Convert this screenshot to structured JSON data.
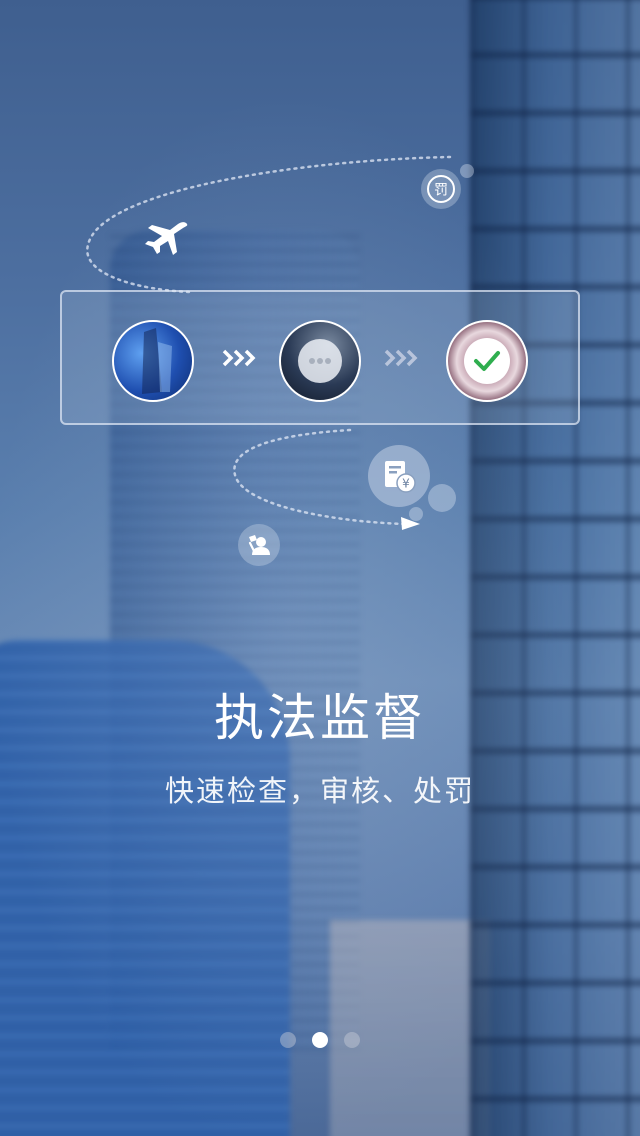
{
  "onboarding": {
    "title": "执法监督",
    "subtitle": "快速检查，审核、处罚",
    "page_indicator": {
      "total": 3,
      "active_index": 1
    }
  },
  "icons": {
    "penalty": "penalty-badge-icon",
    "plane": "airplane-icon",
    "fine_document": "fine-document-icon",
    "officer": "officer-user-icon",
    "step1": "building-photo-icon",
    "step2": "processing-dots-icon",
    "step3": "approved-check-icon",
    "arrows": "triple-chevron-icon"
  },
  "icon_text": {
    "penalty_glyph": "罚",
    "fine_glyph": "¥"
  },
  "colors": {
    "check": "#2fae4f",
    "accent_white": "#ffffff"
  }
}
